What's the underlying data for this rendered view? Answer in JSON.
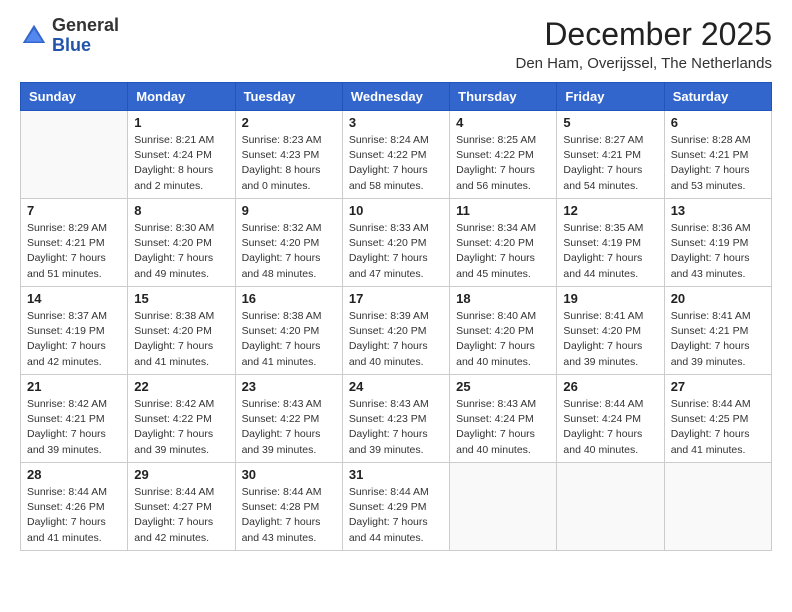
{
  "header": {
    "logo_general": "General",
    "logo_blue": "Blue",
    "month_title": "December 2025",
    "location": "Den Ham, Overijssel, The Netherlands"
  },
  "days_of_week": [
    "Sunday",
    "Monday",
    "Tuesday",
    "Wednesday",
    "Thursday",
    "Friday",
    "Saturday"
  ],
  "weeks": [
    [
      {
        "day": "",
        "info": ""
      },
      {
        "day": "1",
        "info": "Sunrise: 8:21 AM\nSunset: 4:24 PM\nDaylight: 8 hours\nand 2 minutes."
      },
      {
        "day": "2",
        "info": "Sunrise: 8:23 AM\nSunset: 4:23 PM\nDaylight: 8 hours\nand 0 minutes."
      },
      {
        "day": "3",
        "info": "Sunrise: 8:24 AM\nSunset: 4:22 PM\nDaylight: 7 hours\nand 58 minutes."
      },
      {
        "day": "4",
        "info": "Sunrise: 8:25 AM\nSunset: 4:22 PM\nDaylight: 7 hours\nand 56 minutes."
      },
      {
        "day": "5",
        "info": "Sunrise: 8:27 AM\nSunset: 4:21 PM\nDaylight: 7 hours\nand 54 minutes."
      },
      {
        "day": "6",
        "info": "Sunrise: 8:28 AM\nSunset: 4:21 PM\nDaylight: 7 hours\nand 53 minutes."
      }
    ],
    [
      {
        "day": "7",
        "info": "Sunrise: 8:29 AM\nSunset: 4:21 PM\nDaylight: 7 hours\nand 51 minutes."
      },
      {
        "day": "8",
        "info": "Sunrise: 8:30 AM\nSunset: 4:20 PM\nDaylight: 7 hours\nand 49 minutes."
      },
      {
        "day": "9",
        "info": "Sunrise: 8:32 AM\nSunset: 4:20 PM\nDaylight: 7 hours\nand 48 minutes."
      },
      {
        "day": "10",
        "info": "Sunrise: 8:33 AM\nSunset: 4:20 PM\nDaylight: 7 hours\nand 47 minutes."
      },
      {
        "day": "11",
        "info": "Sunrise: 8:34 AM\nSunset: 4:20 PM\nDaylight: 7 hours\nand 45 minutes."
      },
      {
        "day": "12",
        "info": "Sunrise: 8:35 AM\nSunset: 4:19 PM\nDaylight: 7 hours\nand 44 minutes."
      },
      {
        "day": "13",
        "info": "Sunrise: 8:36 AM\nSunset: 4:19 PM\nDaylight: 7 hours\nand 43 minutes."
      }
    ],
    [
      {
        "day": "14",
        "info": "Sunrise: 8:37 AM\nSunset: 4:19 PM\nDaylight: 7 hours\nand 42 minutes."
      },
      {
        "day": "15",
        "info": "Sunrise: 8:38 AM\nSunset: 4:20 PM\nDaylight: 7 hours\nand 41 minutes."
      },
      {
        "day": "16",
        "info": "Sunrise: 8:38 AM\nSunset: 4:20 PM\nDaylight: 7 hours\nand 41 minutes."
      },
      {
        "day": "17",
        "info": "Sunrise: 8:39 AM\nSunset: 4:20 PM\nDaylight: 7 hours\nand 40 minutes."
      },
      {
        "day": "18",
        "info": "Sunrise: 8:40 AM\nSunset: 4:20 PM\nDaylight: 7 hours\nand 40 minutes."
      },
      {
        "day": "19",
        "info": "Sunrise: 8:41 AM\nSunset: 4:20 PM\nDaylight: 7 hours\nand 39 minutes."
      },
      {
        "day": "20",
        "info": "Sunrise: 8:41 AM\nSunset: 4:21 PM\nDaylight: 7 hours\nand 39 minutes."
      }
    ],
    [
      {
        "day": "21",
        "info": "Sunrise: 8:42 AM\nSunset: 4:21 PM\nDaylight: 7 hours\nand 39 minutes."
      },
      {
        "day": "22",
        "info": "Sunrise: 8:42 AM\nSunset: 4:22 PM\nDaylight: 7 hours\nand 39 minutes."
      },
      {
        "day": "23",
        "info": "Sunrise: 8:43 AM\nSunset: 4:22 PM\nDaylight: 7 hours\nand 39 minutes."
      },
      {
        "day": "24",
        "info": "Sunrise: 8:43 AM\nSunset: 4:23 PM\nDaylight: 7 hours\nand 39 minutes."
      },
      {
        "day": "25",
        "info": "Sunrise: 8:43 AM\nSunset: 4:24 PM\nDaylight: 7 hours\nand 40 minutes."
      },
      {
        "day": "26",
        "info": "Sunrise: 8:44 AM\nSunset: 4:24 PM\nDaylight: 7 hours\nand 40 minutes."
      },
      {
        "day": "27",
        "info": "Sunrise: 8:44 AM\nSunset: 4:25 PM\nDaylight: 7 hours\nand 41 minutes."
      }
    ],
    [
      {
        "day": "28",
        "info": "Sunrise: 8:44 AM\nSunset: 4:26 PM\nDaylight: 7 hours\nand 41 minutes."
      },
      {
        "day": "29",
        "info": "Sunrise: 8:44 AM\nSunset: 4:27 PM\nDaylight: 7 hours\nand 42 minutes."
      },
      {
        "day": "30",
        "info": "Sunrise: 8:44 AM\nSunset: 4:28 PM\nDaylight: 7 hours\nand 43 minutes."
      },
      {
        "day": "31",
        "info": "Sunrise: 8:44 AM\nSunset: 4:29 PM\nDaylight: 7 hours\nand 44 minutes."
      },
      {
        "day": "",
        "info": ""
      },
      {
        "day": "",
        "info": ""
      },
      {
        "day": "",
        "info": ""
      }
    ]
  ]
}
